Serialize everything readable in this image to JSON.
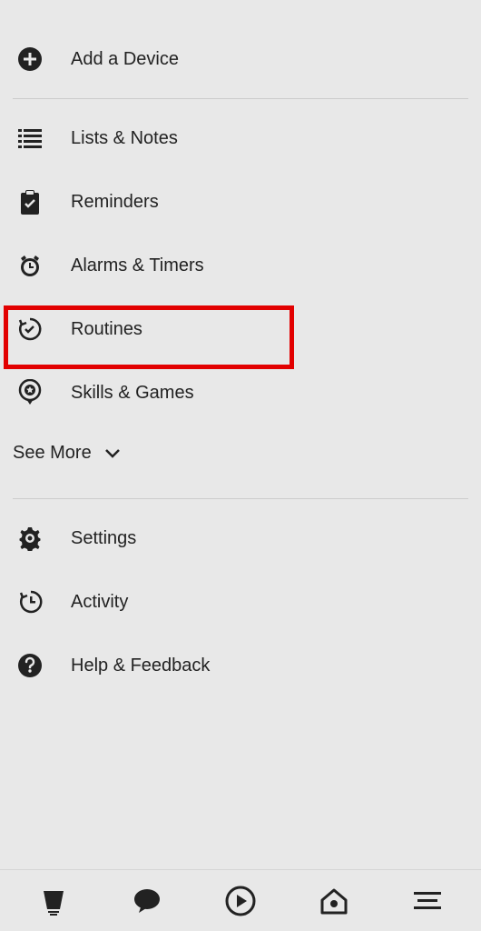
{
  "menu": {
    "group1": [
      {
        "icon": "plus-circle-icon",
        "label": "Add a Device"
      }
    ],
    "group2": [
      {
        "icon": "list-icon",
        "label": "Lists & Notes"
      },
      {
        "icon": "clipboard-check-icon",
        "label": "Reminders"
      },
      {
        "icon": "alarm-icon",
        "label": "Alarms & Timers"
      },
      {
        "icon": "routine-icon",
        "label": "Routines"
      },
      {
        "icon": "star-pin-icon",
        "label": "Skills & Games"
      }
    ],
    "see_more_label": "See More",
    "group3": [
      {
        "icon": "gear-icon",
        "label": "Settings"
      },
      {
        "icon": "history-icon",
        "label": "Activity"
      },
      {
        "icon": "help-icon",
        "label": "Help & Feedback"
      }
    ]
  },
  "bottom_nav": [
    {
      "name": "home-icon"
    },
    {
      "name": "chat-icon"
    },
    {
      "name": "play-icon"
    },
    {
      "name": "devices-icon"
    },
    {
      "name": "more-icon"
    }
  ],
  "highlights": {
    "routines": true,
    "more_tab": true
  }
}
